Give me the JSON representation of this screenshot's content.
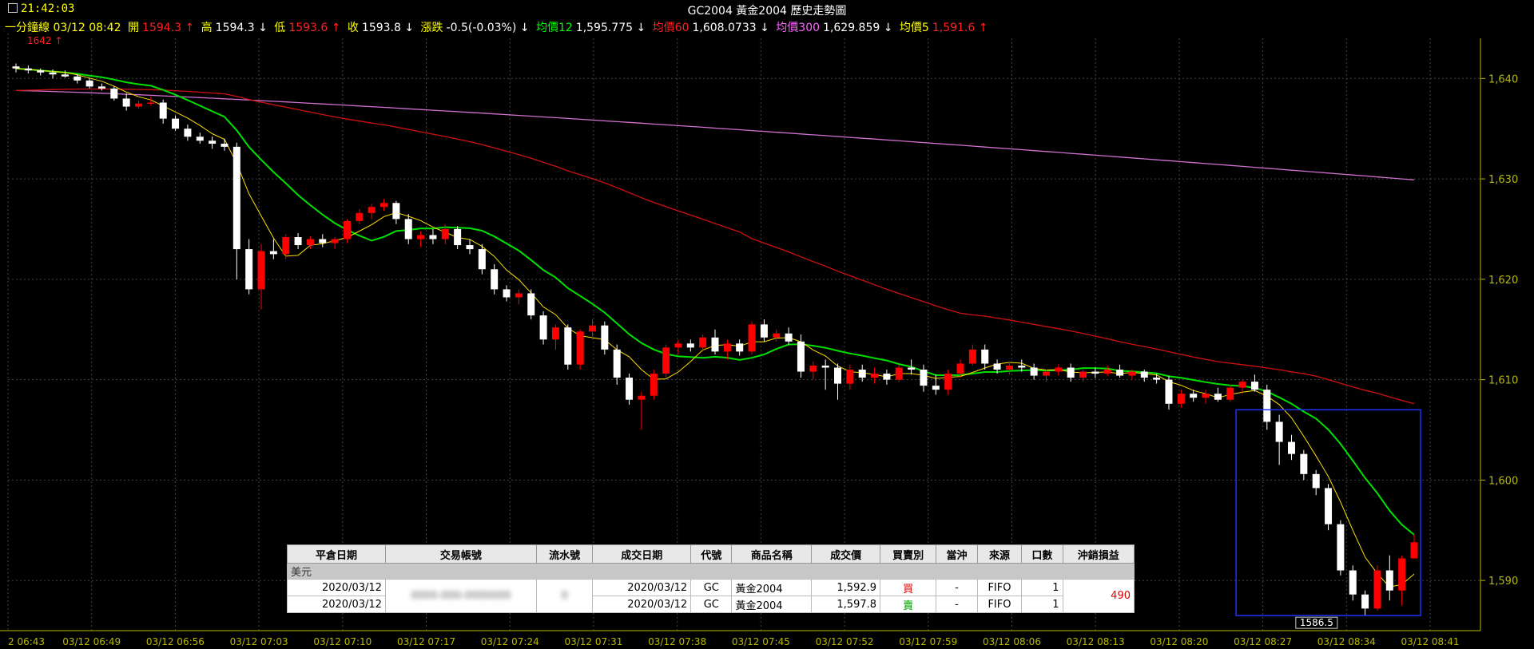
{
  "header": {
    "clock": "21:42:03",
    "title": "GC2004 黃金2004 歷史走勢圖"
  },
  "infobar": {
    "period": "一分鐘線 03/12 08:42",
    "open_label": "開",
    "open": "1594.3 ↑",
    "high_label": "高",
    "high": "1594.3 ↓",
    "low_label": "低",
    "low": "1593.6 ↑",
    "close_label": "收",
    "close": "1593.8 ↓",
    "chg_label": "漲跌",
    "chg": "-0.5(-0.03%) ↓",
    "ma12_label": "均價12",
    "ma12": "1,595.775 ↓",
    "ma60_label": "均價60",
    "ma60": "1,608.0733 ↓",
    "ma300_label": "均價300",
    "ma300": "1,629.859 ↓",
    "ma5_label": "均價5",
    "ma5": "1,591.6 ↑"
  },
  "annotations": {
    "max_label": "1642 ↑",
    "min_label": "1586.5"
  },
  "colors": {
    "up": "#ff0000",
    "down": "#ffffff",
    "ma5": "#ffe000",
    "ma12": "#00e000",
    "ma60": "#d01010",
    "ma300": "#d070d0",
    "axis": "#b8b800",
    "box": "#2030ff"
  },
  "chart_data": {
    "type": "candlestick",
    "title": "GC2004 黃金2004 歷史走勢圖",
    "ylim": [
      1585,
      1644
    ],
    "y_ticks": [
      1590,
      1600,
      1610,
      1620,
      1630,
      1640
    ],
    "y_tick_labels": [
      "1,590",
      "1,600",
      "1,610",
      "1,620",
      "1,630",
      "1,640"
    ],
    "x_tick_labels": [
      "2 06:43",
      "03/12 06:49",
      "03/12 06:56",
      "03/12 07:03",
      "03/12 07:10",
      "03/12 07:17",
      "03/12 07:24",
      "03/12 07:31",
      "03/12 07:38",
      "03/12 07:45",
      "03/12 07:52",
      "03/12 07:59",
      "03/12 08:06",
      "03/12 08:13",
      "03/12 08:20",
      "03/12 08:27",
      "03/12 08:34",
      "03/12 08:41"
    ],
    "candles": [
      [
        1641.2,
        1641.5,
        1640.6,
        1641.0
      ],
      [
        1641.0,
        1641.3,
        1640.5,
        1640.8
      ],
      [
        1640.8,
        1641.0,
        1640.3,
        1640.6
      ],
      [
        1640.6,
        1640.9,
        1640.0,
        1640.4
      ],
      [
        1640.4,
        1640.8,
        1640.1,
        1640.2
      ],
      [
        1640.2,
        1640.4,
        1639.5,
        1639.8
      ],
      [
        1639.8,
        1640.0,
        1639.0,
        1639.2
      ],
      [
        1639.2,
        1639.5,
        1638.8,
        1639.0
      ],
      [
        1639.0,
        1639.2,
        1637.8,
        1638.0
      ],
      [
        1638.0,
        1638.5,
        1636.8,
        1637.2
      ],
      [
        1637.2,
        1637.8,
        1637.0,
        1637.5
      ],
      [
        1637.5,
        1638.2,
        1637.3,
        1637.6
      ],
      [
        1637.6,
        1637.9,
        1635.5,
        1636.0
      ],
      [
        1636.0,
        1636.3,
        1634.8,
        1635.0
      ],
      [
        1635.0,
        1635.4,
        1633.8,
        1634.2
      ],
      [
        1634.2,
        1634.6,
        1633.5,
        1633.8
      ],
      [
        1633.8,
        1634.2,
        1633.0,
        1633.5
      ],
      [
        1633.5,
        1634.0,
        1632.8,
        1633.2
      ],
      [
        1633.2,
        1633.6,
        1620.0,
        1623.0
      ],
      [
        1623.0,
        1624.0,
        1618.5,
        1619.0
      ],
      [
        1619.0,
        1623.5,
        1617.0,
        1622.8
      ],
      [
        1622.8,
        1624.0,
        1622.0,
        1622.5
      ],
      [
        1622.5,
        1624.5,
        1622.0,
        1624.2
      ],
      [
        1624.2,
        1624.6,
        1623.0,
        1623.4
      ],
      [
        1623.4,
        1624.3,
        1623.0,
        1624.0
      ],
      [
        1624.0,
        1624.5,
        1623.2,
        1623.6
      ],
      [
        1623.6,
        1624.2,
        1623.0,
        1624.0
      ],
      [
        1624.0,
        1626.0,
        1623.6,
        1625.8
      ],
      [
        1625.8,
        1627.0,
        1625.5,
        1626.6
      ],
      [
        1626.6,
        1627.5,
        1626.0,
        1627.2
      ],
      [
        1627.2,
        1628.0,
        1626.8,
        1627.6
      ],
      [
        1627.6,
        1627.8,
        1625.5,
        1626.0
      ],
      [
        1626.0,
        1626.5,
        1623.5,
        1624.0
      ],
      [
        1624.0,
        1624.8,
        1623.2,
        1624.4
      ],
      [
        1624.4,
        1625.0,
        1623.5,
        1624.0
      ],
      [
        1624.0,
        1625.5,
        1623.5,
        1625.0
      ],
      [
        1625.0,
        1625.3,
        1623.0,
        1623.4
      ],
      [
        1623.4,
        1624.0,
        1622.5,
        1623.0
      ],
      [
        1623.0,
        1623.5,
        1620.5,
        1621.0
      ],
      [
        1621.0,
        1621.5,
        1618.5,
        1619.0
      ],
      [
        1619.0,
        1619.4,
        1617.8,
        1618.2
      ],
      [
        1618.2,
        1619.0,
        1617.5,
        1618.6
      ],
      [
        1618.6,
        1619.0,
        1616.0,
        1616.4
      ],
      [
        1616.4,
        1616.8,
        1613.5,
        1614.0
      ],
      [
        1614.0,
        1615.5,
        1613.0,
        1615.2
      ],
      [
        1615.2,
        1615.5,
        1611.0,
        1611.5
      ],
      [
        1611.5,
        1615.0,
        1611.0,
        1614.8
      ],
      [
        1614.8,
        1616.0,
        1614.0,
        1615.4
      ],
      [
        1615.4,
        1615.8,
        1612.5,
        1613.0
      ],
      [
        1613.0,
        1613.5,
        1609.5,
        1610.2
      ],
      [
        1610.2,
        1610.6,
        1607.5,
        1608.0
      ],
      [
        1608.0,
        1608.8,
        1605.0,
        1608.4
      ],
      [
        1608.4,
        1611.0,
        1608.0,
        1610.6
      ],
      [
        1610.6,
        1613.5,
        1610.2,
        1613.2
      ],
      [
        1613.2,
        1614.0,
        1612.5,
        1613.6
      ],
      [
        1613.6,
        1614.0,
        1612.8,
        1613.2
      ],
      [
        1613.2,
        1614.5,
        1612.8,
        1614.2
      ],
      [
        1614.2,
        1615.0,
        1612.5,
        1612.8
      ],
      [
        1612.8,
        1614.0,
        1612.0,
        1613.6
      ],
      [
        1613.6,
        1614.0,
        1612.4,
        1612.8
      ],
      [
        1612.8,
        1615.8,
        1612.5,
        1615.5
      ],
      [
        1615.5,
        1616.0,
        1613.8,
        1614.2
      ],
      [
        1614.2,
        1615.0,
        1613.8,
        1614.6
      ],
      [
        1614.6,
        1615.2,
        1613.5,
        1613.8
      ],
      [
        1613.8,
        1614.5,
        1610.2,
        1610.8
      ],
      [
        1610.8,
        1611.8,
        1610.0,
        1611.4
      ],
      [
        1611.4,
        1612.0,
        1609.0,
        1611.2
      ],
      [
        1611.2,
        1611.6,
        1608.0,
        1609.6
      ],
      [
        1609.6,
        1611.5,
        1609.0,
        1611.0
      ],
      [
        1611.0,
        1611.5,
        1609.8,
        1610.2
      ],
      [
        1610.2,
        1611.2,
        1609.6,
        1610.6
      ],
      [
        1610.6,
        1611.0,
        1609.5,
        1610.0
      ],
      [
        1610.0,
        1611.5,
        1609.8,
        1611.2
      ],
      [
        1611.2,
        1612.0,
        1610.5,
        1611.0
      ],
      [
        1611.0,
        1611.5,
        1608.8,
        1609.4
      ],
      [
        1609.4,
        1610.5,
        1608.5,
        1609.0
      ],
      [
        1609.0,
        1611.0,
        1608.5,
        1610.6
      ],
      [
        1610.6,
        1612.0,
        1610.2,
        1611.6
      ],
      [
        1611.6,
        1613.5,
        1611.4,
        1613.0
      ],
      [
        1613.0,
        1613.5,
        1611.0,
        1611.6
      ],
      [
        1611.6,
        1612.0,
        1610.6,
        1611.0
      ],
      [
        1611.0,
        1611.8,
        1610.5,
        1611.4
      ],
      [
        1611.4,
        1612.0,
        1610.8,
        1611.2
      ],
      [
        1611.2,
        1611.6,
        1610.0,
        1610.4
      ],
      [
        1610.4,
        1611.0,
        1609.8,
        1610.8
      ],
      [
        1610.8,
        1611.5,
        1610.4,
        1611.2
      ],
      [
        1611.2,
        1611.6,
        1609.8,
        1610.2
      ],
      [
        1610.2,
        1611.0,
        1609.8,
        1610.8
      ],
      [
        1610.8,
        1611.2,
        1610.2,
        1610.6
      ],
      [
        1610.6,
        1611.4,
        1610.4,
        1611.0
      ],
      [
        1611.0,
        1611.5,
        1610.2,
        1610.4
      ],
      [
        1610.4,
        1611.0,
        1610.0,
        1610.8
      ],
      [
        1610.8,
        1611.0,
        1609.8,
        1610.2
      ],
      [
        1610.2,
        1610.6,
        1609.6,
        1610.0
      ],
      [
        1610.0,
        1610.4,
        1607.0,
        1607.6
      ],
      [
        1607.6,
        1609.0,
        1607.2,
        1608.6
      ],
      [
        1608.6,
        1609.0,
        1607.8,
        1608.2
      ],
      [
        1608.2,
        1609.0,
        1607.6,
        1608.6
      ],
      [
        1608.6,
        1609.2,
        1607.8,
        1608.0
      ],
      [
        1608.0,
        1609.5,
        1607.8,
        1609.2
      ],
      [
        1609.2,
        1610.0,
        1608.6,
        1609.8
      ],
      [
        1609.8,
        1610.5,
        1608.8,
        1609.0
      ],
      [
        1609.0,
        1609.5,
        1605.0,
        1605.8
      ],
      [
        1605.8,
        1606.5,
        1601.5,
        1603.8
      ],
      [
        1603.8,
        1604.5,
        1602.0,
        1602.6
      ],
      [
        1602.6,
        1603.0,
        1600.0,
        1600.6
      ],
      [
        1600.6,
        1601.0,
        1598.5,
        1599.2
      ],
      [
        1599.2,
        1599.6,
        1595.0,
        1595.6
      ],
      [
        1595.6,
        1596.0,
        1590.5,
        1591.0
      ],
      [
        1591.0,
        1591.5,
        1588.0,
        1588.6
      ],
      [
        1588.6,
        1589.0,
        1586.5,
        1587.2
      ],
      [
        1587.2,
        1591.5,
        1587.0,
        1591.0
      ],
      [
        1591.0,
        1592.5,
        1588.0,
        1589.0
      ],
      [
        1589.0,
        1592.5,
        1587.5,
        1592.2
      ],
      [
        1592.2,
        1594.6,
        1593.3,
        1593.8
      ]
    ],
    "series": [
      {
        "name": "均價5"
      },
      {
        "name": "均價12"
      },
      {
        "name": "均價60"
      },
      {
        "name": "均價300"
      }
    ]
  },
  "trade_table": {
    "headers": [
      "平倉日期",
      "交易帳號",
      "流水號",
      "成交日期",
      "代號",
      "商品名稱",
      "成交價",
      "買賣別",
      "當沖",
      "來源",
      "口數",
      "沖銷損益"
    ],
    "group_label": "美元",
    "rows": [
      {
        "close_date": "2020/03/12",
        "account": "0000-000-0000000",
        "serial": "0",
        "trade_date": "2020/03/12",
        "code": "GC",
        "name": "黃金2004",
        "price": "1,592.9",
        "side": "買",
        "daytrade": "-",
        "source": "FIFO",
        "qty": "1"
      },
      {
        "close_date": "2020/03/12",
        "account": "",
        "serial": "",
        "trade_date": "2020/03/12",
        "code": "GC",
        "name": "黃金2004",
        "price": "1,597.8",
        "side": "賣",
        "daytrade": "-",
        "source": "FIFO",
        "qty": "1"
      }
    ],
    "pnl": "490"
  }
}
